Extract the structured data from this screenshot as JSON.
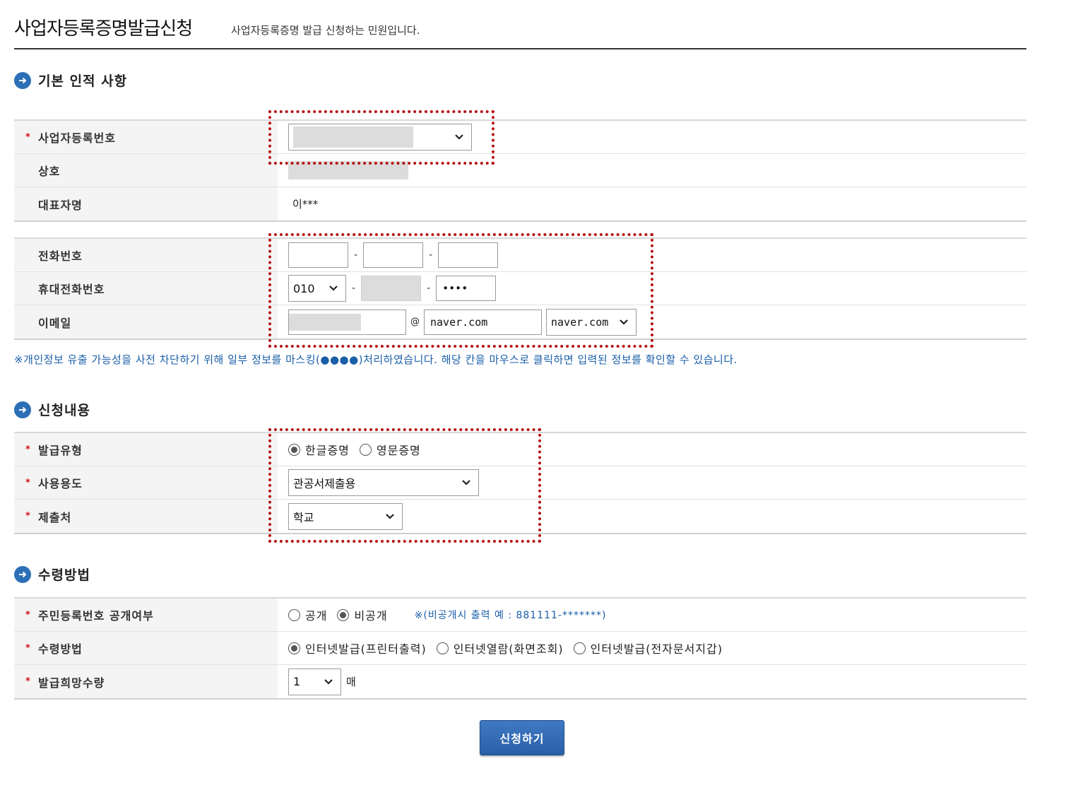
{
  "header": {
    "title": "사업자등록증명발급신청",
    "subtitle": "사업자등록증명 발급 신청하는 민원입니다."
  },
  "sections": {
    "basic_info": "기본 인적 사항",
    "application": "신청내용",
    "receipt": "수령방법"
  },
  "basic": {
    "biz_no_label": "사업자등록번호",
    "company_label": "상호",
    "ceo_label": "대표자명",
    "ceo_value": "이***"
  },
  "contact": {
    "phone_label": "전화번호",
    "mobile_label": "휴대전화번호",
    "mobile_prefix": "010",
    "mobile_last": "••••",
    "email_label": "이메일",
    "email_at": "@",
    "email_domain": "naver.com",
    "email_domain_select": "naver.com",
    "dash": "-"
  },
  "notice": "※개인정보 유출 가능성을 사전 차단하기 위해 일부 정보를 마스킹(●●●●)처리하였습니다. 해당 칸을 마우스로 클릭하면 입력된 정보를 확인할 수 있습니다.",
  "application": {
    "type_label": "발급유형",
    "type_korean": "한글증명",
    "type_english": "영문증명",
    "purpose_label": "사용용도",
    "purpose_value": "관공서제출용",
    "submit_to_label": "제출처",
    "submit_to_value": "학교"
  },
  "receipt": {
    "rrn_label": "주민등록번호 공개여부",
    "rrn_public": "공개",
    "rrn_private": "비공개",
    "rrn_hint": "※(비공개시 출력 예 : 881111-*******)",
    "method_label": "수령방법",
    "method_print": "인터넷발급(프린터출력)",
    "method_view": "인터넷열람(화면조회)",
    "method_edoc": "인터넷발급(전자문서지갑)",
    "qty_label": "발급희망수량",
    "qty_value": "1",
    "qty_unit": "매"
  },
  "required_mark": "*",
  "submit_label": "신청하기",
  "colors": {
    "accent": "#2b6fb6",
    "highlight_box": "#b70f12",
    "notice_text": "#1a5ea8",
    "required": "#d3121b"
  }
}
